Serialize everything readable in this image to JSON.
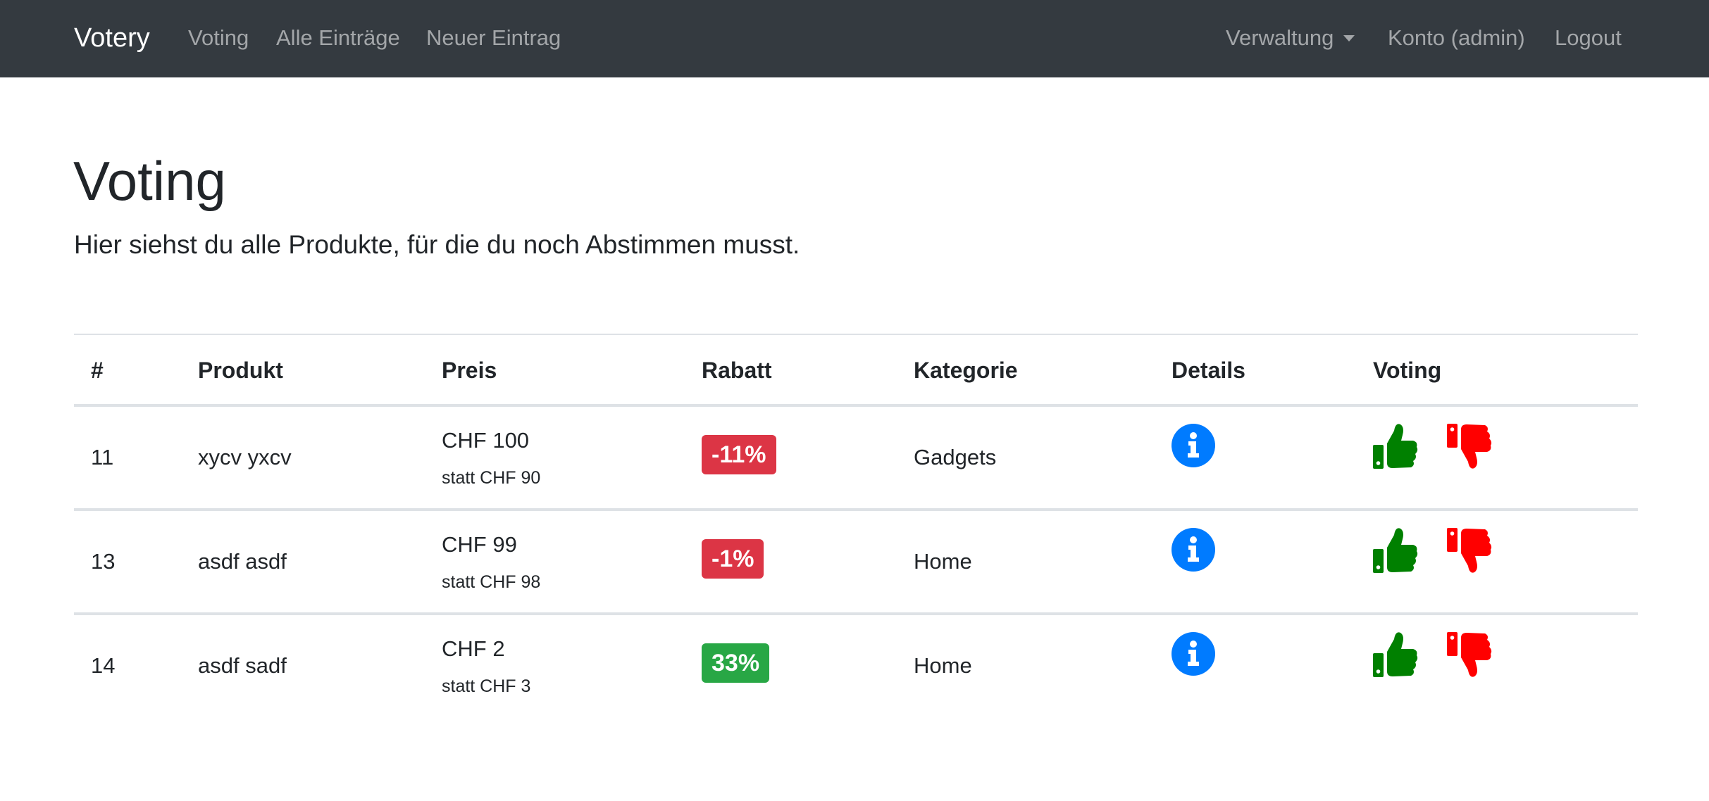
{
  "navbar": {
    "brand": "Votery",
    "links": [
      "Voting",
      "Alle Einträge",
      "Neuer Eintrag"
    ],
    "admin_dropdown": "Verwaltung",
    "account": "Konto (admin)",
    "logout": "Logout",
    "background_color": "#343a40"
  },
  "page": {
    "title": "Voting",
    "lead": "Hier siehst du alle Produkte, für die du noch Abstimmen musst."
  },
  "table": {
    "headers": [
      "#",
      "Produkt",
      "Preis",
      "Rabatt",
      "Kategorie",
      "Details",
      "Voting"
    ],
    "rows": [
      {
        "id": "11",
        "product": "xycv yxcv",
        "price": "CHF 100",
        "price_old": "statt CHF 90",
        "discount": "-11%",
        "discount_status": "danger",
        "category": "Gadgets",
        "details_icon": "info-circle-icon",
        "vote_up_icon": "thumbs-up-icon",
        "vote_down_icon": "thumbs-down-icon"
      },
      {
        "id": "13",
        "product": "asdf asdf",
        "price": "CHF 99",
        "price_old": "statt CHF 98",
        "discount": "-1%",
        "discount_status": "danger",
        "category": "Home",
        "details_icon": "info-circle-icon",
        "vote_up_icon": "thumbs-up-icon",
        "vote_down_icon": "thumbs-down-icon"
      },
      {
        "id": "14",
        "product": "asdf sadf",
        "price": "CHF 2",
        "price_old": "statt CHF 3",
        "discount": "33%",
        "discount_status": "success",
        "category": "Home",
        "details_icon": "info-circle-icon",
        "vote_up_icon": "thumbs-up-icon",
        "vote_down_icon": "thumbs-down-icon"
      }
    ]
  },
  "colors": {
    "info": "#007bff",
    "vote_up": "#008000",
    "vote_down": "#ff0000",
    "danger_badge": "#dc3545",
    "success_badge": "#28a745"
  }
}
